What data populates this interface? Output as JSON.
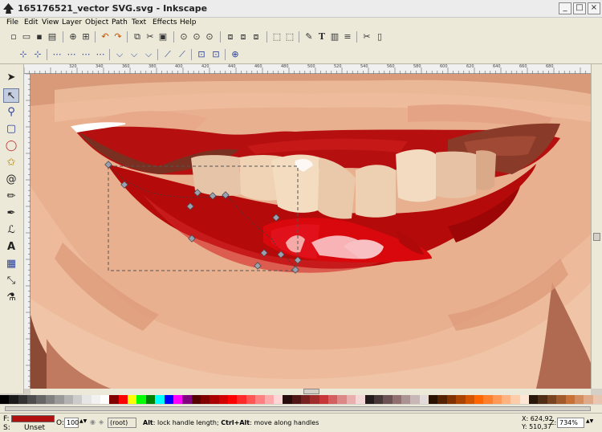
{
  "window": {
    "title": "165176521_vector SVG.svg - Inkscape",
    "minimize": "_",
    "maximize": "□",
    "close": "×"
  },
  "menu": [
    "File",
    "Edit",
    "View",
    "Layer",
    "Object",
    "Path",
    "Text",
    "Effects",
    "Help"
  ],
  "toolbar1_icons": [
    "new-icon",
    "open-icon",
    "save-icon",
    "print-icon",
    "import-icon",
    "export-icon",
    "undo-icon",
    "redo-icon",
    "copy-icon",
    "cut-icon",
    "paste-icon",
    "zoom-selection-icon",
    "zoom-drawing-icon",
    "zoom-page-icon",
    "zoom-width-icon",
    "duplicate-icon",
    "clone-icon",
    "unlink-clone-icon",
    "group-icon",
    "ungroup-icon",
    "fill-stroke-icon",
    "text-font-icon",
    "xml-editor-icon",
    "align-icon",
    "preferences-icon",
    "document-properties-icon"
  ],
  "toolbar2_icons": [
    "insert-node-icon",
    "delete-node-icon",
    "join-nodes-icon",
    "break-path-icon",
    "join-segment-icon",
    "delete-segment-icon",
    "cusp-node-icon",
    "smooth-node-icon",
    "symmetric-node-icon",
    "line-segment-icon",
    "curve-segment-icon",
    "object-to-path-icon",
    "stroke-to-path-icon",
    "show-handles-icon"
  ],
  "tools": [
    "selector-tool-icon",
    "node-tool-icon",
    "zoom-tool-icon",
    "rect-tool-icon",
    "ellipse-tool-icon",
    "star-tool-icon",
    "spiral-tool-icon",
    "pencil-tool-icon",
    "pen-tool-icon",
    "calligraphy-tool-icon",
    "text-tool-icon",
    "gradient-tool-icon",
    "connector-tool-icon",
    "dropper-tool-icon"
  ],
  "ruler_labels": [
    "320",
    "340",
    "360",
    "380",
    "400",
    "420",
    "440",
    "460",
    "480",
    "500",
    "520",
    "540",
    "560",
    "580",
    "600",
    "620",
    "640",
    "660",
    "680"
  ],
  "palette_colors": [
    "#000000",
    "#1a1a1a",
    "#333333",
    "#4d4d4d",
    "#666666",
    "#808080",
    "#999999",
    "#b3b3b3",
    "#cccccc",
    "#e6e6e6",
    "#f2f2f2",
    "#ffffff",
    "#800000",
    "#ff0000",
    "#ffff00",
    "#00ff00",
    "#008000",
    "#00ffff",
    "#0000ff",
    "#ff00ff",
    "#800080",
    "#550000",
    "#800000",
    "#aa0000",
    "#d40000",
    "#ff0000",
    "#ff2a2a",
    "#ff5555",
    "#ff8080",
    "#ffaaaa",
    "#ffd5d5",
    "#280b0b",
    "#501616",
    "#782121",
    "#a02c2c",
    "#c83737",
    "#d35f5f",
    "#de8787",
    "#e9afaf",
    "#f4d7d7",
    "#241c1c",
    "#483737",
    "#6c5353",
    "#916f6f",
    "#ac9393",
    "#c8b7b7",
    "#e3dbdb",
    "#2b1100",
    "#552200",
    "#803300",
    "#aa4400",
    "#d45500",
    "#ff6600",
    "#ff7f2a",
    "#ff9955",
    "#ffb380",
    "#ffccaa",
    "#ffe6d5",
    "#28170b",
    "#502d16",
    "#784421",
    "#a05a2c",
    "#c87137",
    "#d38d5f",
    "#deaa87",
    "#e9c6af"
  ],
  "status": {
    "fill_label": "F:",
    "stroke_label": "S:",
    "fill_color": "#b01010",
    "stroke_value": "Unset",
    "opacity_label": "O:",
    "opacity_value": "100",
    "layer_value": "(root)",
    "message_bold1": "Alt",
    "message_text1": ": lock handle length; ",
    "message_bold2": "Ctrl+Alt",
    "message_text2": ": move along handles",
    "x_coord": "X: 624,92",
    "y_coord": "Y: 510,37",
    "zoom_label": "Z:",
    "zoom_value": "734%"
  }
}
